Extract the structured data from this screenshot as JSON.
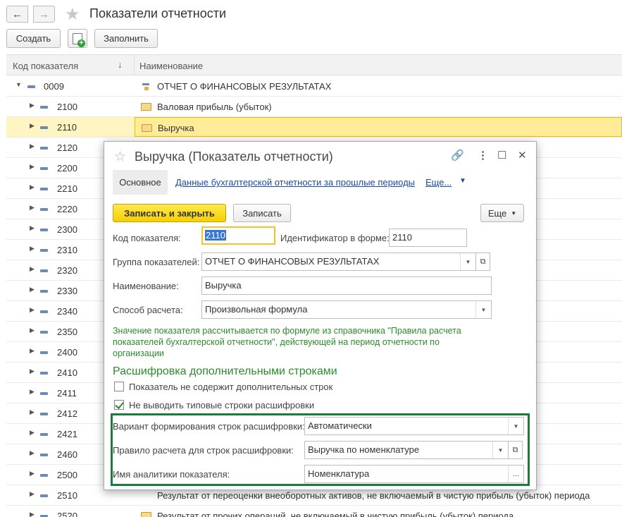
{
  "window": {
    "title": "Показатели отчетности",
    "create_label": "Создать",
    "fill_label": "Заполнить"
  },
  "list": {
    "col_code": "Код показателя",
    "col_name": "Наименование",
    "rows": [
      {
        "code": "0009",
        "name": "ОТЧЕТ О ФИНАНСОВЫХ РЕЗУЛЬТАТАХ"
      },
      {
        "code": "2100",
        "name": "Валовая прибыль (убыток)"
      },
      {
        "code": "2110",
        "name": "Выручка"
      },
      {
        "code": "2120",
        "name": ""
      },
      {
        "code": "2200",
        "name": ""
      },
      {
        "code": "2210",
        "name": ""
      },
      {
        "code": "2220",
        "name": ""
      },
      {
        "code": "2300",
        "name": ""
      },
      {
        "code": "2310",
        "name": ""
      },
      {
        "code": "2320",
        "name": ""
      },
      {
        "code": "2330",
        "name": ""
      },
      {
        "code": "2340",
        "name": ""
      },
      {
        "code": "2350",
        "name": ""
      },
      {
        "code": "2400",
        "name": ""
      },
      {
        "code": "2410",
        "name": ""
      },
      {
        "code": "2411",
        "name": ""
      },
      {
        "code": "2412",
        "name": ""
      },
      {
        "code": "2421",
        "name": ""
      },
      {
        "code": "2460",
        "name": ""
      },
      {
        "code": "2500",
        "name": ""
      },
      {
        "code": "2510",
        "name": "Результат от переоценки внеоборотных активов, не включаемый в чистую прибыль (убыток) периода"
      },
      {
        "code": "2520",
        "name": "Результат от прочих операций, не включаемый в чистую прибыль (убыток) периода"
      }
    ]
  },
  "dialog": {
    "title": "Выручка (Показатель отчетности)",
    "tab_main": "Основное",
    "tab_prev": "Данные бухгалтерской отчетности за прошлые периоды",
    "tab_more": "Еще...",
    "save_close": "Записать и закрыть",
    "save": "Записать",
    "more": "Еще",
    "code_label": "Код показателя:",
    "code_value": "2110",
    "form_id_label": "Идентификатор в форме:",
    "form_id_value": "2110",
    "group_label": "Группа показателей:",
    "group_value": "ОТЧЕТ О ФИНАНСОВЫХ РЕЗУЛЬТАТАХ",
    "name_label": "Наименование:",
    "name_value": "Выручка",
    "calc_label": "Способ расчета:",
    "calc_value": "Произвольная формула",
    "hint": "Значение показателя рассчитывается по формуле из справочника \"Правила расчета показателей бухгалтерской отчетности\", действующей на период отчетности по организации",
    "section_title": "Расшифровка дополнительными строками",
    "check1_label": "Показатель не содержит дополнительных строк",
    "check1_checked": false,
    "check2_label": "Не выводить типовые строки расшифровки",
    "check2_checked": true,
    "variant_label": "Вариант формирования строк расшифровки:",
    "variant_value": "Автоматически",
    "rule_label": "Правило расчета для строк расшифровки:",
    "rule_value": "Выручка по номенклатуре",
    "analytic_label": "Имя аналитики показателя:",
    "analytic_value": "Номенклатура"
  },
  "colors": {
    "accent_yellow": "#f5cf00",
    "hint_green": "#2a8c2a",
    "box_green": "#1c7a3a",
    "link_blue": "#1c4aa8"
  }
}
